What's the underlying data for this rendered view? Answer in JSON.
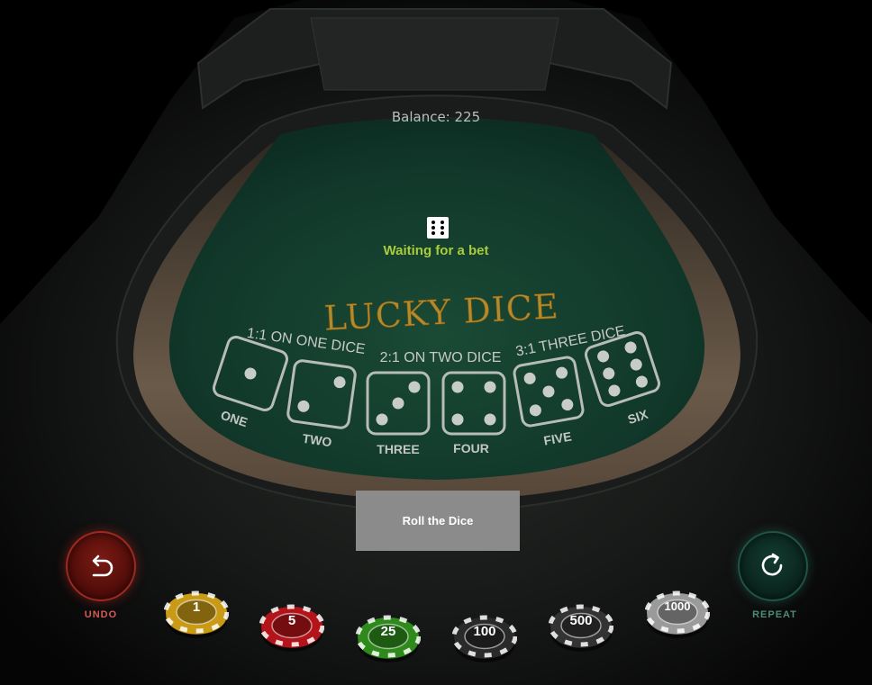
{
  "balance": "Balance: 225",
  "status": {
    "text": "Waiting for a bet",
    "die_face": 6,
    "color": "#a8cd3a"
  },
  "table": {
    "title": "LUCKY DICE",
    "payouts": [
      "1:1 ON ONE DICE",
      "2:1 ON TWO DICE",
      "3:1 THREE DICE"
    ],
    "dice": [
      {
        "label": "ONE",
        "value": 1
      },
      {
        "label": "TWO",
        "value": 2
      },
      {
        "label": "THREE",
        "value": 3
      },
      {
        "label": "FOUR",
        "value": 4
      },
      {
        "label": "FIVE",
        "value": 5
      },
      {
        "label": "SIX",
        "value": 6
      }
    ],
    "felt_color": "#123b2a",
    "title_color": "#b48a2a"
  },
  "controls": {
    "roll_label": "Roll the Dice",
    "undo_label": "UNDO",
    "repeat_label": "REPEAT"
  },
  "chips": [
    {
      "value": "1",
      "color": "#c99a16"
    },
    {
      "value": "5",
      "color": "#b3141a"
    },
    {
      "value": "25",
      "color": "#2f8a1c"
    },
    {
      "value": "100",
      "color": "#2a2a2a"
    },
    {
      "value": "500",
      "color": "#333333"
    },
    {
      "value": "1000",
      "color": "#9a9a9a"
    }
  ]
}
